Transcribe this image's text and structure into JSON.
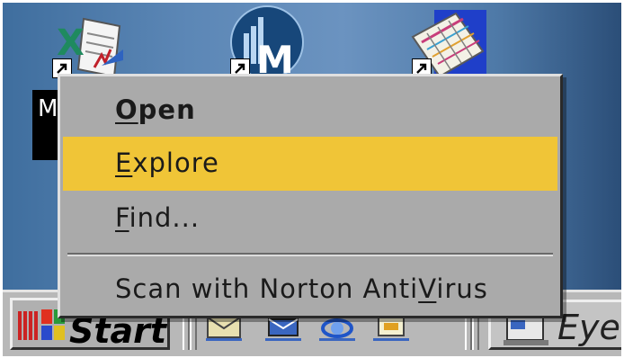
{
  "desktop": {
    "icons": [
      {
        "name": "excel-shortcut-icon"
      },
      {
        "name": "money-shortcut-icon"
      },
      {
        "name": "calendar-shortcut-icon"
      }
    ],
    "selected_label": "M"
  },
  "context_menu": {
    "items": [
      {
        "label": "Open",
        "default": true,
        "highlighted": false
      },
      {
        "label": "Explore",
        "default": false,
        "highlighted": true
      },
      {
        "label": "Find...",
        "default": false,
        "highlighted": false
      },
      {
        "label": "Scan with Norton AntiVirus",
        "default": false,
        "highlighted": false
      }
    ],
    "highlight_color": "#f0c537",
    "background_color": "#aaaaaa"
  },
  "taskbar": {
    "start_label": "Start",
    "task_label": "Eyek",
    "quick_launch": [
      {
        "name": "show-desktop-icon"
      },
      {
        "name": "outlook-express-icon"
      },
      {
        "name": "internet-explorer-icon"
      },
      {
        "name": "channels-icon"
      }
    ]
  }
}
